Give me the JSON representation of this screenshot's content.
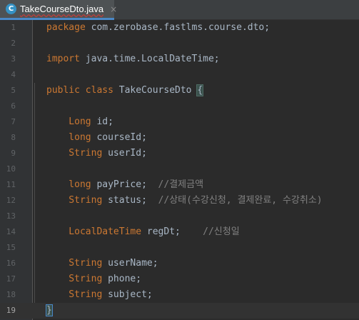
{
  "tab": {
    "file_icon_letter": "C",
    "file_name": "TakeCourseDto.java",
    "close_glyph": "×"
  },
  "editor": {
    "lines": [
      {
        "number": "1",
        "tokens": [
          {
            "t": "package",
            "c": "kw"
          },
          {
            "t": " com.zerobase.fastlms.course.dto;",
            "c": ""
          }
        ]
      },
      {
        "number": "2",
        "tokens": []
      },
      {
        "number": "3",
        "tokens": [
          {
            "t": "import",
            "c": "kw"
          },
          {
            "t": " java.time.LocalDateTime;",
            "c": ""
          }
        ]
      },
      {
        "number": "4",
        "tokens": []
      },
      {
        "number": "5",
        "tokens": [
          {
            "t": "public class",
            "c": "kw"
          },
          {
            "t": " TakeCourseDto ",
            "c": ""
          },
          {
            "t": "{",
            "c": "brace-match"
          }
        ]
      },
      {
        "number": "6",
        "tokens": []
      },
      {
        "number": "7",
        "tokens": [
          {
            "t": "    Long",
            "c": "kw"
          },
          {
            "t": " id;",
            "c": ""
          }
        ]
      },
      {
        "number": "8",
        "tokens": [
          {
            "t": "    long",
            "c": "kw"
          },
          {
            "t": " courseId;",
            "c": ""
          }
        ]
      },
      {
        "number": "9",
        "tokens": [
          {
            "t": "    String",
            "c": "kw"
          },
          {
            "t": " userId;",
            "c": ""
          }
        ]
      },
      {
        "number": "10",
        "tokens": []
      },
      {
        "number": "11",
        "tokens": [
          {
            "t": "    long",
            "c": "kw"
          },
          {
            "t": " payPrice;  ",
            "c": ""
          },
          {
            "t": "//결제금액",
            "c": "cm"
          }
        ]
      },
      {
        "number": "12",
        "tokens": [
          {
            "t": "    String",
            "c": "kw"
          },
          {
            "t": " status;  ",
            "c": ""
          },
          {
            "t": "//상태(수강신청, 결제완료, 수강취소)",
            "c": "cm"
          }
        ]
      },
      {
        "number": "13",
        "tokens": []
      },
      {
        "number": "14",
        "tokens": [
          {
            "t": "    LocalDateTime",
            "c": "kw"
          },
          {
            "t": " regDt;    ",
            "c": ""
          },
          {
            "t": "//신청일",
            "c": "cm"
          }
        ]
      },
      {
        "number": "15",
        "tokens": []
      },
      {
        "number": "16",
        "tokens": [
          {
            "t": "    String",
            "c": "kw"
          },
          {
            "t": " userName;",
            "c": ""
          }
        ]
      },
      {
        "number": "17",
        "tokens": [
          {
            "t": "    String",
            "c": "kw"
          },
          {
            "t": " phone;",
            "c": ""
          }
        ]
      },
      {
        "number": "18",
        "tokens": [
          {
            "t": "    String",
            "c": "kw"
          },
          {
            "t": " subject;",
            "c": ""
          }
        ]
      },
      {
        "number": "19",
        "tokens": [
          {
            "t": "}",
            "c": "caret-brace"
          }
        ],
        "current": true
      }
    ]
  },
  "colors": {
    "keyword": "#cc7832",
    "text": "#a9b7c6",
    "comment": "#808080",
    "background": "#2b2b2b",
    "gutter": "#313335",
    "tab_underline": "#4a88c7"
  }
}
